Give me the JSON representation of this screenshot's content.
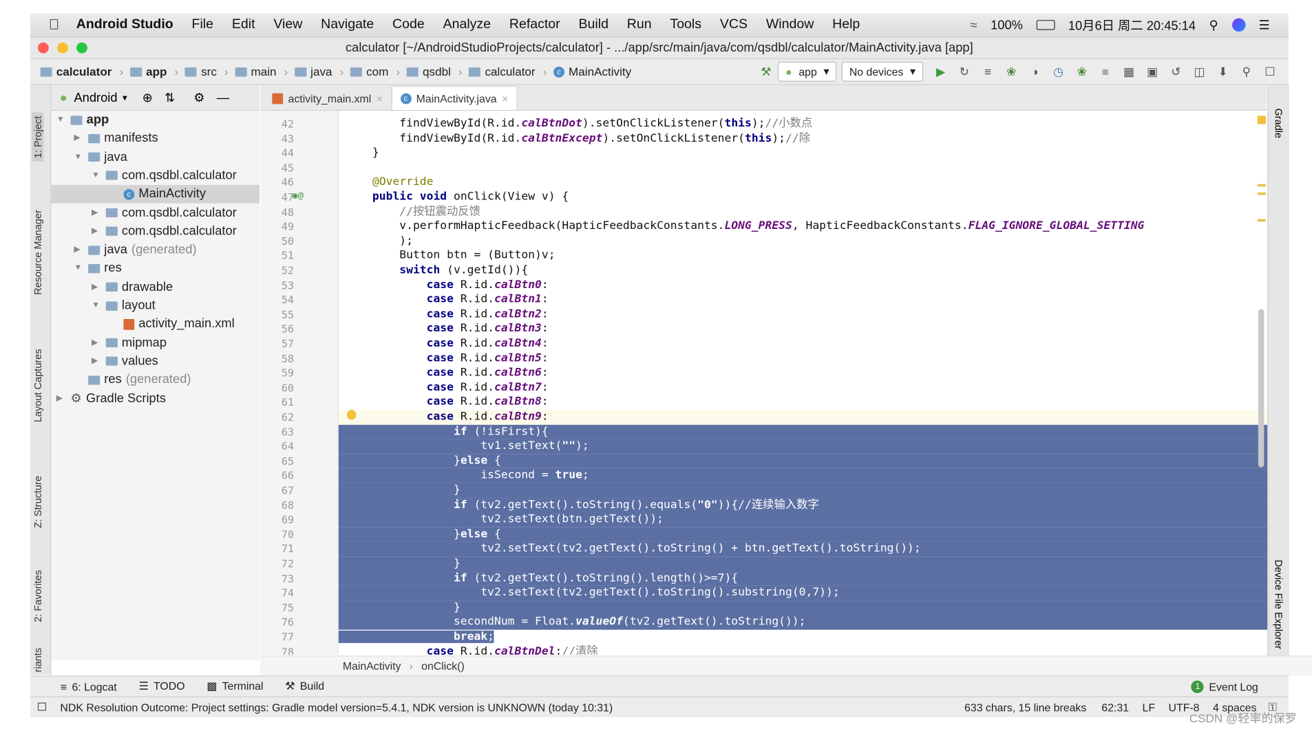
{
  "menubar": {
    "app": "Android Studio",
    "items": [
      "File",
      "Edit",
      "View",
      "Navigate",
      "Code",
      "Analyze",
      "Refactor",
      "Build",
      "Run",
      "Tools",
      "VCS",
      "Window",
      "Help"
    ],
    "battery": "100%",
    "clock": "10月6日 周二  20:45:14"
  },
  "window_title": "calculator [~/AndroidStudioProjects/calculator] - .../app/src/main/java/com/qsdbl/calculator/MainActivity.java [app]",
  "navbar": {
    "crumbs": [
      "calculator",
      "app",
      "src",
      "main",
      "java",
      "com",
      "qsdbl",
      "calculator",
      "MainActivity"
    ],
    "run_config": "app",
    "devices": "No devices"
  },
  "left_tabs": [
    "1: Project",
    "Resource Manager",
    "Layout Captures",
    "Z: Structure",
    "2: Favorites",
    "riants"
  ],
  "right_tabs": [
    "Gradle",
    "Device File Explorer"
  ],
  "project": {
    "view": "Android",
    "tree": [
      {
        "label": "app",
        "depth": 0,
        "open": true,
        "bold": true
      },
      {
        "label": "manifests",
        "depth": 1,
        "open": false
      },
      {
        "label": "java",
        "depth": 1,
        "open": true
      },
      {
        "label": "com.qsdbl.calculator",
        "depth": 2,
        "open": true
      },
      {
        "label": "MainActivity",
        "depth": 3,
        "leaf": true,
        "selected": true
      },
      {
        "label": "com.qsdbl.calculator",
        "depth": 2,
        "open": false,
        "suffix": ""
      },
      {
        "label": "com.qsdbl.calculator",
        "depth": 2,
        "open": false,
        "suffix": ""
      },
      {
        "label": "java",
        "depth": 1,
        "open": false,
        "suffix": " (generated)"
      },
      {
        "label": "res",
        "depth": 1,
        "open": true
      },
      {
        "label": "drawable",
        "depth": 2,
        "open": false
      },
      {
        "label": "layout",
        "depth": 2,
        "open": true
      },
      {
        "label": "activity_main.xml",
        "depth": 3,
        "leaf": true
      },
      {
        "label": "mipmap",
        "depth": 2,
        "open": false
      },
      {
        "label": "values",
        "depth": 2,
        "open": false
      },
      {
        "label": "res",
        "depth": 1,
        "leaf": true,
        "suffix": " (generated)"
      },
      {
        "label": "Gradle Scripts",
        "depth": 0,
        "open": false
      }
    ]
  },
  "tabs": [
    {
      "label": "activity_main.xml",
      "active": false
    },
    {
      "label": "MainActivity.java",
      "active": true
    }
  ],
  "editor": {
    "first_line": 42,
    "current_line": 62,
    "lines": [
      "        findViewById(R.id.calBtnDot).setOnClickListener(this);//小数点",
      "        findViewById(R.id.calBtnExcept).setOnClickListener(this);//除",
      "    }",
      "",
      "    @Override",
      "    public void onClick(View v) {",
      "        //按钮震动反馈",
      "        v.performHapticFeedback(HapticFeedbackConstants.LONG_PRESS, HapticFeedbackConstants.FLAG_IGNORE_GLOBAL_SETTING",
      "        );",
      "        Button btn = (Button)v;",
      "        switch (v.getId()){",
      "            case R.id.calBtn0:",
      "            case R.id.calBtn1:",
      "            case R.id.calBtn2:",
      "            case R.id.calBtn3:",
      "            case R.id.calBtn4:",
      "            case R.id.calBtn5:",
      "            case R.id.calBtn6:",
      "            case R.id.calBtn7:",
      "            case R.id.calBtn8:",
      "            case R.id.calBtn9:",
      "                if (!isFirst){",
      "                    tv1.setText(\"\");",
      "                }else {",
      "                    isSecond = true;",
      "                }",
      "                if (tv2.getText().toString().equals(\"0\")){//连续输入数字",
      "                    tv2.setText(btn.getText());",
      "                }else {",
      "                    tv2.setText(tv2.getText().toString() + btn.getText().toString());",
      "                }",
      "                if (tv2.getText().toString().length()>=7){",
      "                    tv2.setText(tv2.getText().toString().substring(0,7));",
      "                }",
      "                secondNum = Float.valueOf(tv2.getText().toString());",
      "                break;",
      "            case R.id.calBtnDel://清除"
    ]
  },
  "breadcrumb_bottom": [
    "MainActivity",
    "onClick()"
  ],
  "bottom_tools": [
    "6: Logcat",
    "TODO",
    "Terminal",
    "Build"
  ],
  "event_log": {
    "count": "1",
    "label": "Event Log"
  },
  "status": {
    "message": "NDK Resolution Outcome: Project settings: Gradle model version=5.4.1, NDK version is UNKNOWN (today 10:31)",
    "selection": "633 chars, 15 line breaks",
    "position": "62:31",
    "line_sep": "LF",
    "encoding": "UTF-8",
    "indent": "4 spaces"
  },
  "watermark": "CSDN @轻率的保罗"
}
